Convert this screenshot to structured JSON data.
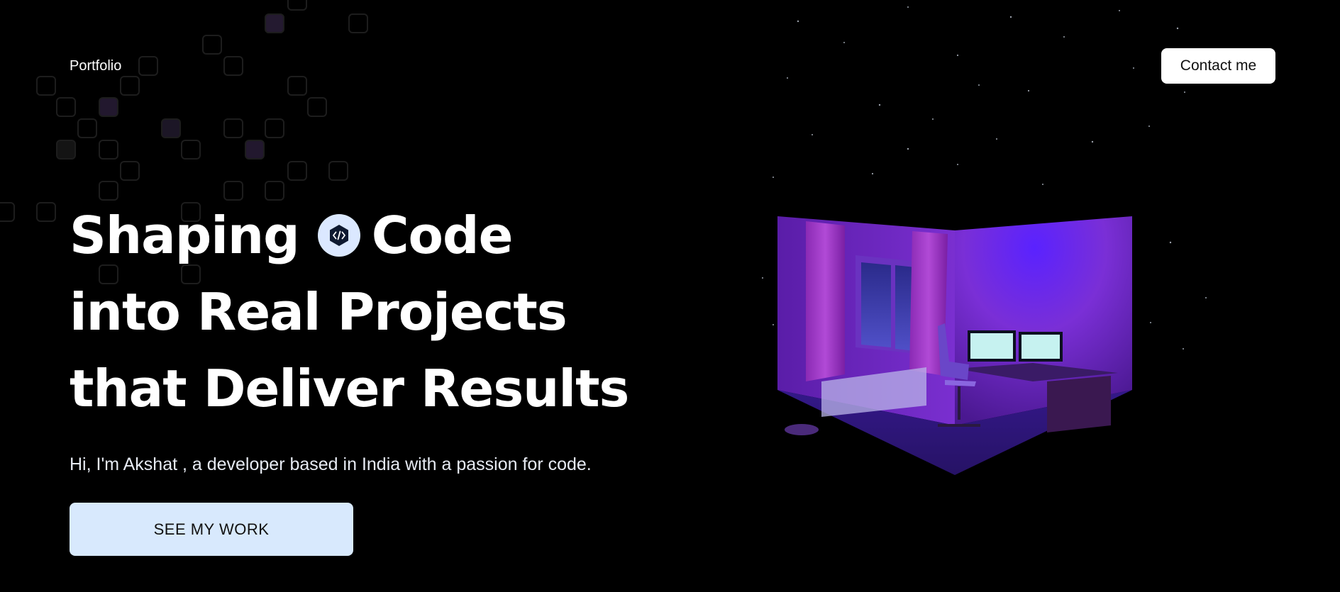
{
  "nav": {
    "brand": "Portfolio",
    "contact_label": "Contact me"
  },
  "hero": {
    "line1_pre": "Shaping",
    "line1_post": "Code",
    "line2": "into Real Projects",
    "line3": "that Deliver Results",
    "badge_icon": "code-icon",
    "intro": "Hi, I'm Akshat , a developer based in India with a passion for code.",
    "cta_label": "SEE MY WORK"
  },
  "illustration": {
    "subject": "isometric-room-icon",
    "accent": "#7b2fe0"
  },
  "colors": {
    "background": "#000000",
    "cta_background": "#d8e9fd",
    "badge_background": "#dbe8ff"
  }
}
